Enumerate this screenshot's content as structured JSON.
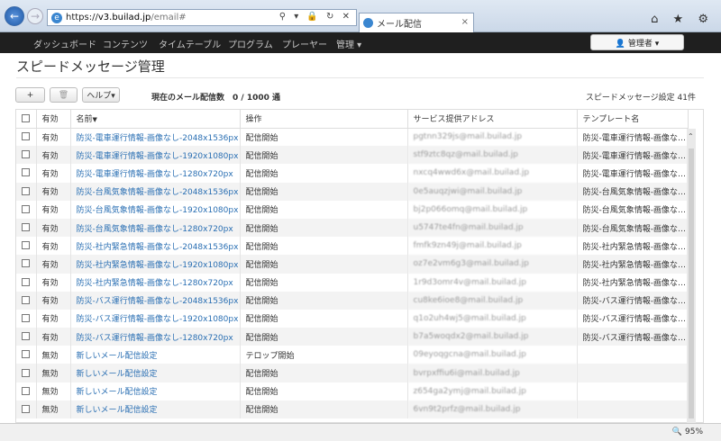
{
  "browser": {
    "url_scheme": "https://",
    "url_domain": "v3.builad.jp",
    "url_path": "/email#",
    "tab_title": "メール配信",
    "tab_close": "×",
    "address_icons": "⚲ ▾ 🔒 ↻ ✕",
    "toolbar_icons": "⌂ ★ ⚙",
    "zoom": "🔍 95%"
  },
  "nav": {
    "items": [
      "ダッシュボード",
      "コンテンツ",
      "タイムテーブル",
      "プログラム",
      "プレーヤー",
      "管理 ▾"
    ],
    "user": "👤 管理者 ▾"
  },
  "page": {
    "title": "スピードメッセージ管理",
    "add_label": "+",
    "delete_label": "🗑",
    "help_label": "ヘルプ▾",
    "counter": "現在のメール配信数　0 / 1000 通",
    "count_right": "スピードメッセージ設定 41件"
  },
  "table": {
    "headers": [
      "有効",
      "名前",
      "操作",
      "サービス提供アドレス",
      "テンプレート名"
    ],
    "sort_marker": "▼",
    "rows": [
      [
        "有効",
        "防災-電車運行情報-画像なし-2048x1536px",
        "配信開始",
        "pgtnn329js@mail.builad.jp",
        "防災-電車運行情報-画像な…"
      ],
      [
        "有効",
        "防災-電車運行情報-画像なし-1920x1080px",
        "配信開始",
        "stf9ztc8qz@mail.builad.jp",
        "防災-電車運行情報-画像な…"
      ],
      [
        "有効",
        "防災-電車運行情報-画像なし-1280x720px",
        "配信開始",
        "nxcq4wwd6x@mail.builad.jp",
        "防災-電車運行情報-画像な…"
      ],
      [
        "有効",
        "防災-台風気象情報-画像なし-2048x1536px",
        "配信開始",
        "0e5auqzjwi@mail.builad.jp",
        "防災-台風気象情報-画像な…"
      ],
      [
        "有効",
        "防災-台風気象情報-画像なし-1920x1080px",
        "配信開始",
        "bj2p066omq@mail.builad.jp",
        "防災-台風気象情報-画像な…"
      ],
      [
        "有効",
        "防災-台風気象情報-画像なし-1280x720px",
        "配信開始",
        "u5747te4fn@mail.builad.jp",
        "防災-台風気象情報-画像な…"
      ],
      [
        "有効",
        "防災-社内緊急情報-画像なし-2048x1536px",
        "配信開始",
        "fmfk9zn49j@mail.builad.jp",
        "防災-社内緊急情報-画像な…"
      ],
      [
        "有効",
        "防災-社内緊急情報-画像なし-1920x1080px",
        "配信開始",
        "oz7e2vm6g3@mail.builad.jp",
        "防災-社内緊急情報-画像な…"
      ],
      [
        "有効",
        "防災-社内緊急情報-画像なし-1280x720px",
        "配信開始",
        "1r9d3omr4v@mail.builad.jp",
        "防災-社内緊急情報-画像な…"
      ],
      [
        "有効",
        "防災-バス運行情報-画像なし-2048x1536px",
        "配信開始",
        "cu8ke6ioe8@mail.builad.jp",
        "防災-バス運行情報-画像な…"
      ],
      [
        "有効",
        "防災-バス運行情報-画像なし-1920x1080px",
        "配信開始",
        "q1o2uh4wj5@mail.builad.jp",
        "防災-バス運行情報-画像な…"
      ],
      [
        "有効",
        "防災-バス運行情報-画像なし-1280x720px",
        "配信開始",
        "b7a5woqdx2@mail.builad.jp",
        "防災-バス運行情報-画像な…"
      ],
      [
        "無効",
        "新しいメール配信設定",
        "テロップ開始",
        "09eyoqgcna@mail.builad.jp",
        ""
      ],
      [
        "無効",
        "新しいメール配信設定",
        "配信開始",
        "bvrpxffiu6i@mail.builad.jp",
        ""
      ],
      [
        "無効",
        "新しいメール配信設定",
        "配信開始",
        "z654ga2ymj@mail.builad.jp",
        ""
      ],
      [
        "無効",
        "新しいメール配信設定",
        "配信開始",
        "6vn9t2prfz@mail.builad.jp",
        ""
      ]
    ]
  }
}
